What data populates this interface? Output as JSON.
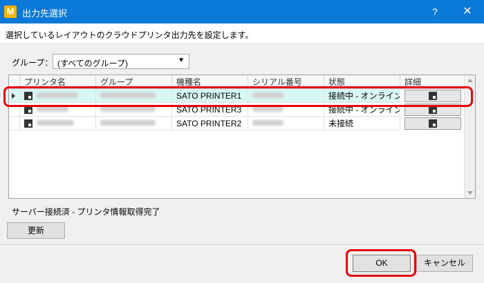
{
  "window": {
    "app_icon_letter": "M",
    "title": "出力先選択",
    "help_label": "?",
    "close_label": "✕"
  },
  "description": "選択しているレイアウトのクラウドプリンタ出力先を設定します。",
  "group": {
    "label": "グループ：",
    "value": "(すべてのグループ)"
  },
  "table": {
    "columns": [
      "プリンタ名",
      "グループ",
      "機種名",
      "シリアル番号",
      "状態",
      "詳細"
    ],
    "rows": [
      {
        "model": "SATO PRINTER1",
        "status": "接続中 - オンライン",
        "selected": true
      },
      {
        "model": "SATO PRINTER3",
        "status": "接続中 - オンライン",
        "selected": false
      },
      {
        "model": "SATO PRINTER2",
        "status": "未接続",
        "selected": false
      }
    ]
  },
  "status_text": "サーバー接続済 - プリンタ情報取得完了",
  "buttons": {
    "refresh": "更新",
    "ok": "OK",
    "cancel": "キャンセル"
  },
  "colors": {
    "titlebar": "#0a79d7",
    "selected_row": "#d8f6f3",
    "highlight": "#e6000a"
  }
}
